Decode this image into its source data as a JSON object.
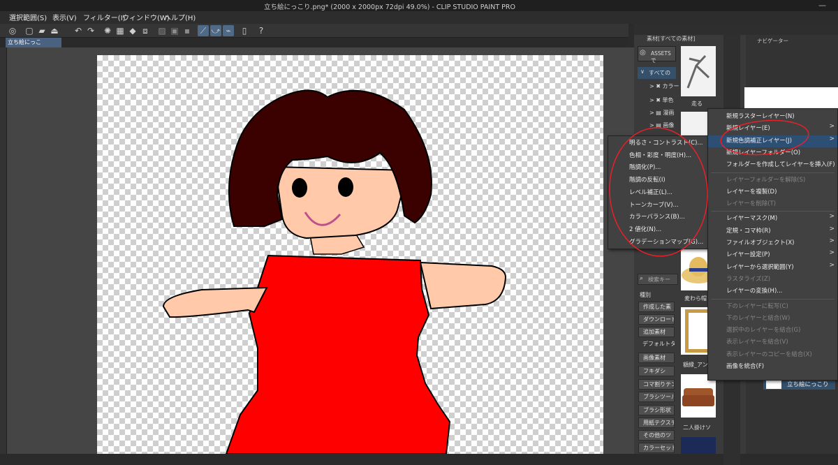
{
  "app": {
    "title": "立ち絵にっこり.png* (2000 x 2000px 72dpi 49.0%)  - CLIP STUDIO PAINT PRO"
  },
  "menubar": [
    "選択範囲(S)",
    "表示(V)",
    "フィルター(I)",
    "ウィンドウ(W)",
    "ヘルプ(H)"
  ],
  "document_tab": {
    "label": "立ち絵にっこり.png*"
  },
  "asset_panel": {
    "header": "素材[すべての素材]",
    "assets_button": "ASSETSで",
    "tree": [
      "すべての",
      "カラー",
      "単色",
      "漫画",
      "画像"
    ],
    "thumbnails": [
      "走る",
      "麦わら帽",
      "額縁_アンテ",
      "二人掛けソ"
    ],
    "search_placeholder": "検索キー",
    "type_label": "種別",
    "type_buttons": [
      "作成した素",
      "ダウンロード",
      "追加素材",
      "デフォルトタ",
      "画像素材",
      "フキダシ",
      "コマ割りテン",
      "ブラシツール",
      "ブラシ形状",
      "用紙テクスチ",
      "その他のツ",
      "カラーセット"
    ]
  },
  "navigator": {
    "label": "ナビゲーター"
  },
  "layer_item": {
    "label": "立ち絵にっこり"
  },
  "layer_menu": [
    {
      "label": "新規ラスターレイヤー(N)",
      "disabled": false,
      "submenu": false
    },
    {
      "label": "新規レイヤー(E)",
      "disabled": false,
      "submenu": true
    },
    {
      "label": "新規色調補正レイヤー(J)",
      "disabled": false,
      "submenu": true,
      "highlight": true
    },
    {
      "label": "新規レイヤーフォルダー(O)",
      "disabled": false,
      "submenu": false
    },
    {
      "label": "フォルダーを作成してレイヤーを挿入(F)",
      "disabled": false,
      "submenu": false
    },
    {
      "label": "レイヤーフォルダーを解除(S)",
      "disabled": true,
      "submenu": false
    },
    {
      "label": "レイヤーを複製(D)",
      "disabled": false,
      "submenu": false
    },
    {
      "label": "レイヤーを削除(T)",
      "disabled": true,
      "submenu": false
    },
    {
      "label": "レイヤーマスク(M)",
      "disabled": false,
      "submenu": true
    },
    {
      "label": "定規・コマ枠(R)",
      "disabled": false,
      "submenu": true
    },
    {
      "label": "ファイルオブジェクト(X)",
      "disabled": false,
      "submenu": true
    },
    {
      "label": "レイヤー設定(P)",
      "disabled": false,
      "submenu": true
    },
    {
      "label": "レイヤーから選択範囲(Y)",
      "disabled": false,
      "submenu": true
    },
    {
      "label": "ラスタライズ(Z)",
      "disabled": true,
      "submenu": false
    },
    {
      "label": "レイヤーの変換(H)...",
      "disabled": false,
      "submenu": false
    },
    {
      "label": "下のレイヤーに転写(C)",
      "disabled": true,
      "submenu": false
    },
    {
      "label": "下のレイヤーと結合(W)",
      "disabled": true,
      "submenu": false
    },
    {
      "label": "選択中のレイヤーを結合(G)",
      "disabled": true,
      "submenu": false
    },
    {
      "label": "表示レイヤーを結合(V)",
      "disabled": true,
      "submenu": false
    },
    {
      "label": "表示レイヤーのコピーを結合(X)",
      "disabled": true,
      "submenu": false
    },
    {
      "label": "画像を統合(F)",
      "disabled": false,
      "submenu": false
    }
  ],
  "adjust_menu": [
    "明るさ・コントラスト(C)...",
    "色相・彩度・明度(H)...",
    "階調化(P)...",
    "階調の反転(I)",
    "レベル補正(L)...",
    "トーンカーブ(V)...",
    "カラーバランス(B)...",
    "2 値化(N)...",
    "グラデーションマップ(G)..."
  ],
  "colors": {
    "annotation": "#e8202a",
    "highlight": "#2d4f73",
    "dress": "#ff0000",
    "hair": "#3b0000",
    "skin": "#ffc9aa"
  }
}
